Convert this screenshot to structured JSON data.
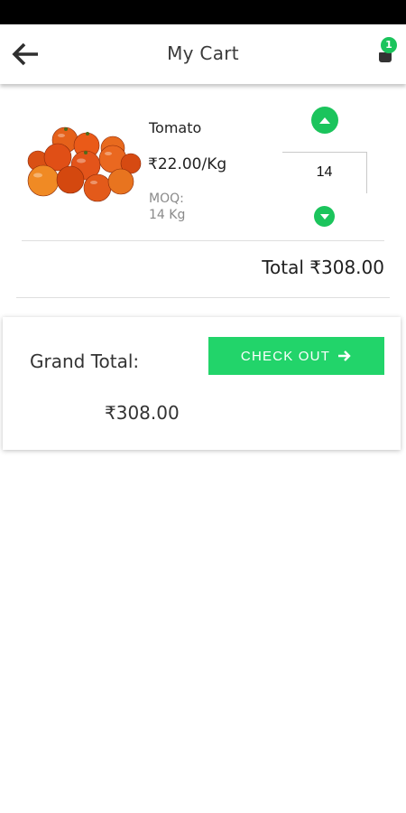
{
  "header": {
    "title": "My Cart",
    "cart_count": "1"
  },
  "cart_item": {
    "name": "Tomato",
    "price": "₹22.00/Kg",
    "moq_label": "MOQ:",
    "moq_value": "14 Kg",
    "quantity": "14",
    "total": "Total ₹308.00"
  },
  "summary": {
    "grand_total_label": "Grand Total:",
    "grand_total_value": "₹308.00",
    "checkout_label": "CHECK OUT"
  },
  "icons": {
    "back": "arrow-left-icon",
    "cart": "cart-icon",
    "increase": "chevron-up-icon",
    "decrease": "chevron-down-icon",
    "checkout": "arrow-right-icon"
  },
  "colors": {
    "accent_green": "#1bc45c",
    "checkout_green": "#22d46a"
  }
}
